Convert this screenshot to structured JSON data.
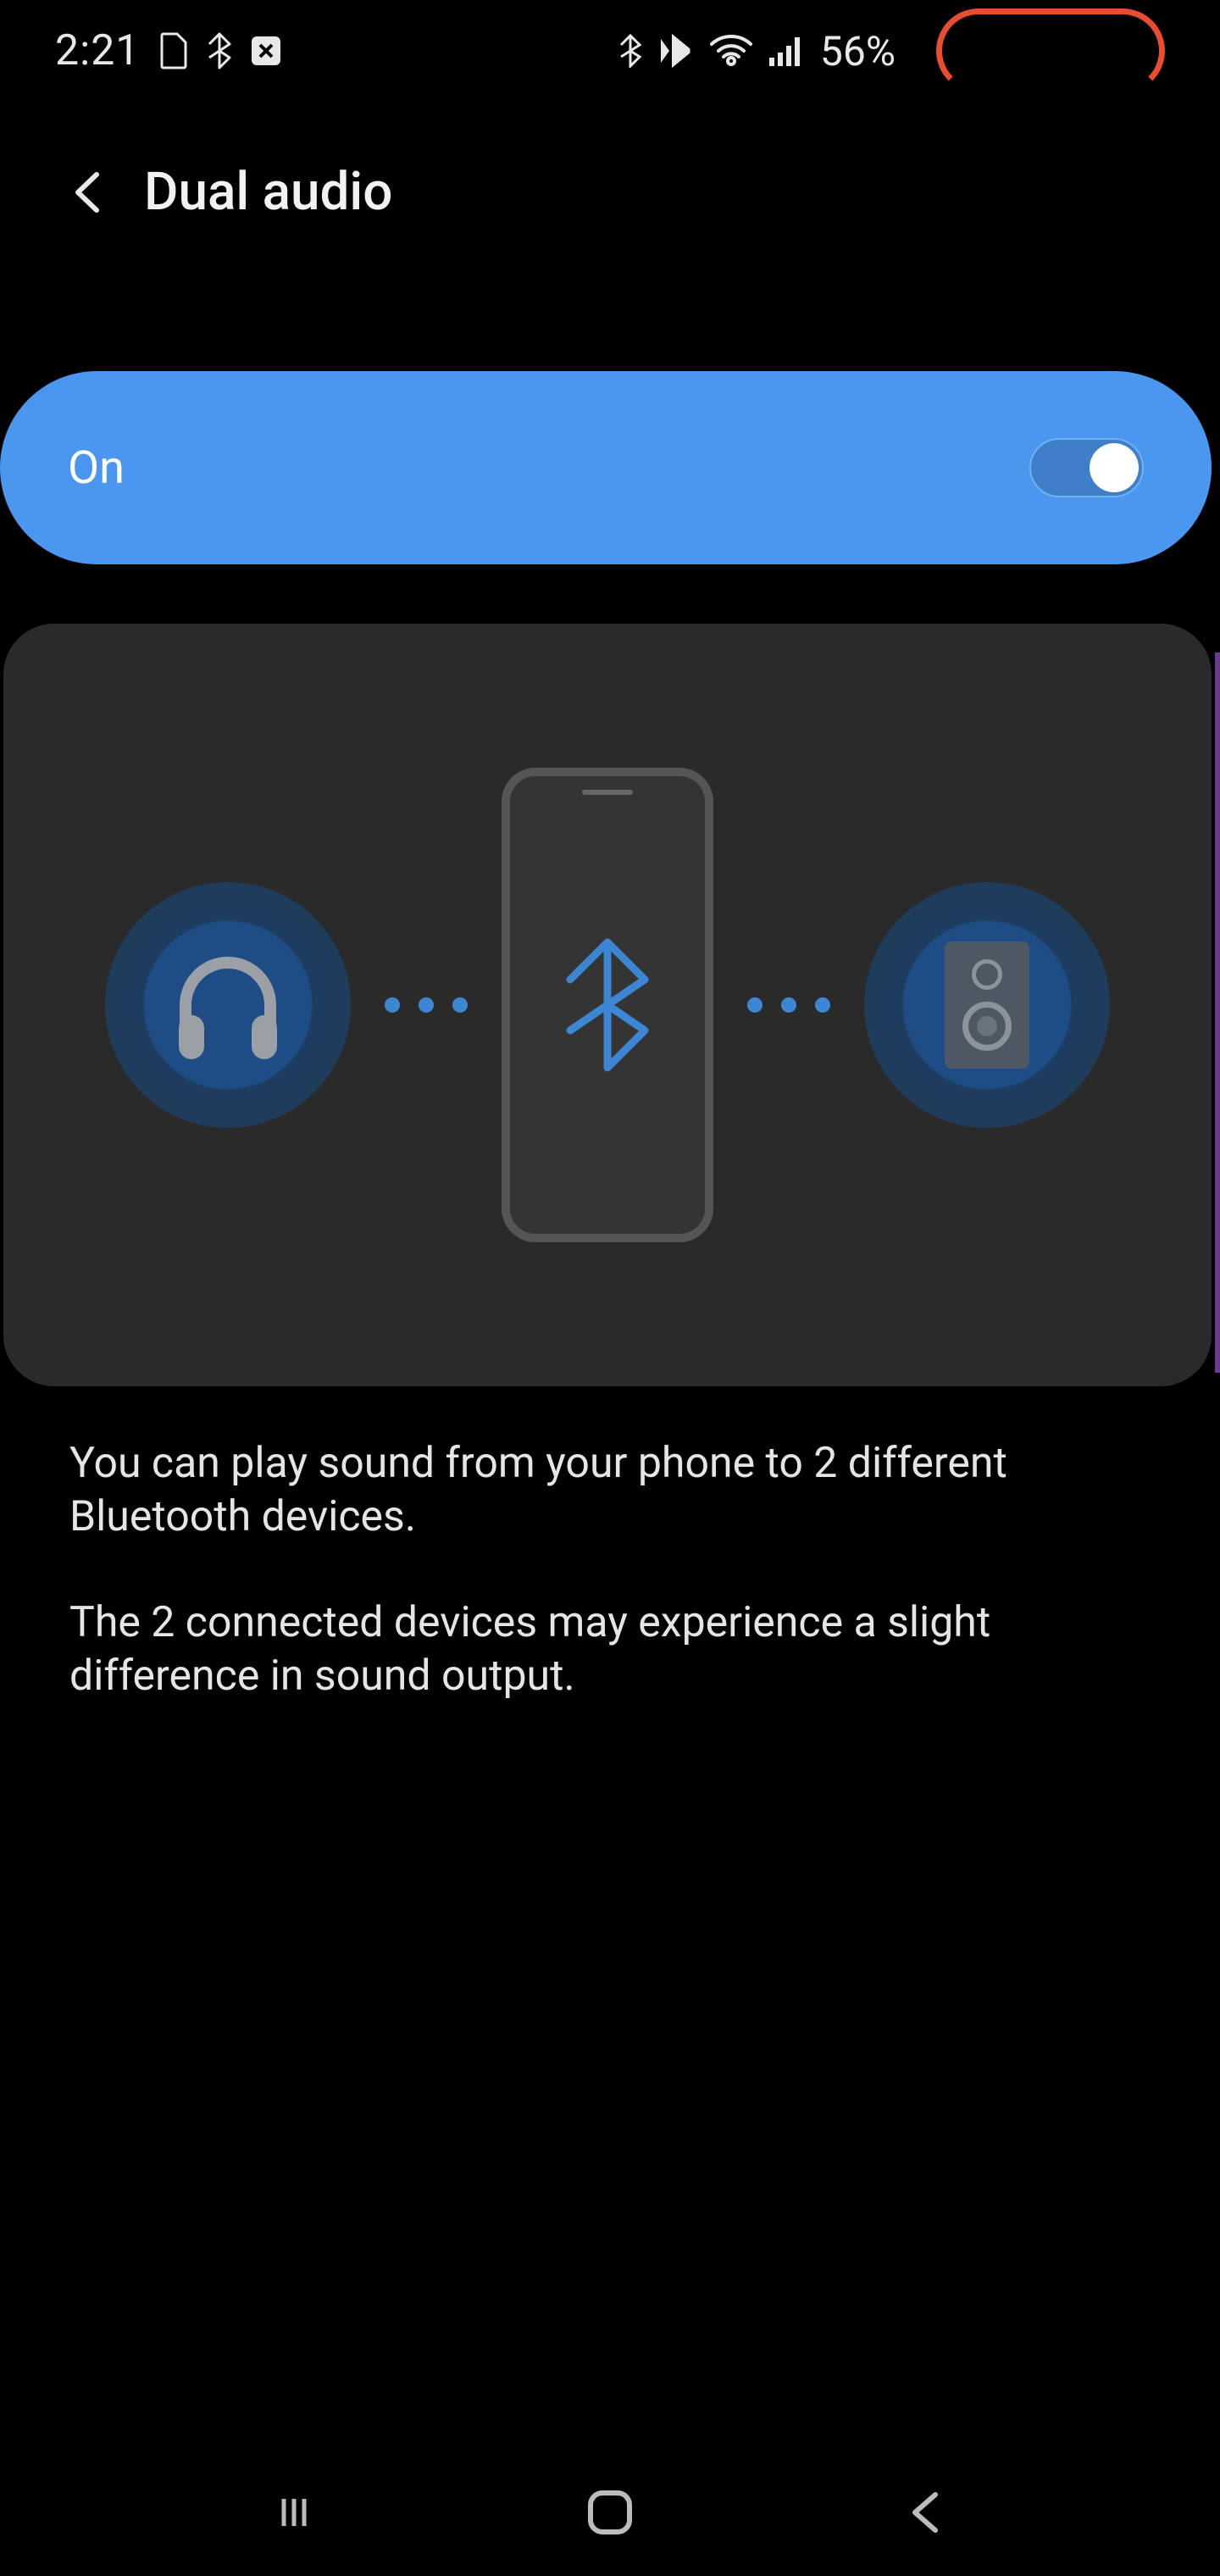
{
  "status": {
    "time": "2:21",
    "battery_text": "56%"
  },
  "header": {
    "title": "Dual audio"
  },
  "toggle": {
    "label": "On",
    "checked": true
  },
  "description": {
    "p1": "You can play sound from your phone to 2 different Bluetooth devices.",
    "p2": "The 2 connected devices may experience a slight difference in sound output."
  },
  "colors": {
    "accent": "#4b97f0",
    "bt_blue": "#3d86d3",
    "battery_ring": "#e84d2f"
  }
}
